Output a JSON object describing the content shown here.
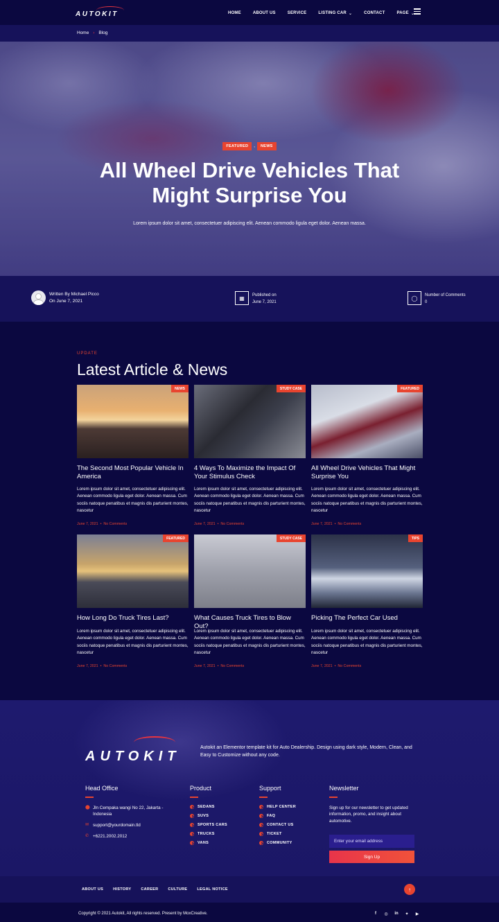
{
  "header": {
    "logo_text": "AUTOKIT",
    "nav": [
      "HOME",
      "ABOUT US",
      "SERVICE",
      "LISTING CAR",
      "CONTACT",
      "PAGE"
    ]
  },
  "breadcrumb": {
    "home": "Home",
    "current": "Blog"
  },
  "hero": {
    "tags": [
      "FEATURED",
      "NEWS"
    ],
    "title_line1": "All Wheel Drive Vehicles That",
    "title_line2": "Might Surprise You",
    "subtitle": "Lorem ipsum dolor sit amet, consectetuer adipiscing elit. Aenean commodo ligula eget dolor. Aenean massa."
  },
  "meta": {
    "author_label": "Written By Michael Picco",
    "author_date": "On June 7, 2021",
    "published_label": "Published on",
    "published_date": "June 7, 2021",
    "comments_label": "Number of Comments",
    "comments_count": "0"
  },
  "articles": {
    "label": "UPDATE",
    "title": "Latest Article & News",
    "excerpt": "Lorem ipsum dolor sit amet, consectetuer adipiscing elit. Aenean commodo ligula eget dolor. Aenean massa. Cum sociis natoque penatibus et magnis dis parturient montes, nascetur",
    "date": "June 7, 2021",
    "comments": "No Comments",
    "cards": [
      {
        "tag": "NEWS",
        "title": "The Second Most Popular Vehicle In America"
      },
      {
        "tag": "STUDY CASE",
        "title": "4 Ways To Maximize the Impact Of Your Stimulus Check"
      },
      {
        "tag": "FEATURED",
        "title": "All Wheel Drive Vehicles That Might Surprise You"
      },
      {
        "tag": "FEATURED",
        "title": "How Long Do Truck Tires Last?"
      },
      {
        "tag": "STUDY CASE",
        "title": "What Causes Truck Tires to Blow Out?"
      },
      {
        "tag": "TIPS",
        "title": "Picking The Perfect Car Used"
      }
    ]
  },
  "footer": {
    "logo_text": "AUTOKIT",
    "about": "Autokit an Elementor template kit for Auto Dealership. Design using dark style, Modern, Clean, and Easy to Customize without any code.",
    "head_office": {
      "title": "Head Office",
      "address": "Jln Cempaka wangi No 22, Jakarta - Indonesia",
      "email": "support@yourdomain.tld",
      "phone": "+6221.2002.2012"
    },
    "product": {
      "title": "Product",
      "items": [
        "SEDANS",
        "SUVS",
        "SPORTS CARS",
        "TRUCKS",
        "VANS"
      ]
    },
    "support": {
      "title": "Support",
      "items": [
        "HELP CENTER",
        "FAQ",
        "CONTACT US",
        "TICKET",
        "COMMUNITY"
      ]
    },
    "newsletter": {
      "title": "Newsletter",
      "description": "Sign up for our newsletter to get updated information, promo, and insight about automotive.",
      "placeholder": "Enter your email address",
      "button": "Sign Up"
    },
    "bottom_links": [
      "ABOUT US",
      "HISTORY",
      "CAREER",
      "CULTURE",
      "LEGAL NOTICE"
    ],
    "copyright": "Copyright © 2021 Autokit, All rights reserved. Present by MoxCreative.",
    "socials": [
      "facebook-icon",
      "instagram-icon",
      "linkedin-icon",
      "twitter-icon",
      "youtube-icon"
    ]
  },
  "colors": {
    "accent": "#e8442f",
    "background": "#0b0840",
    "panel": "#16125a"
  }
}
